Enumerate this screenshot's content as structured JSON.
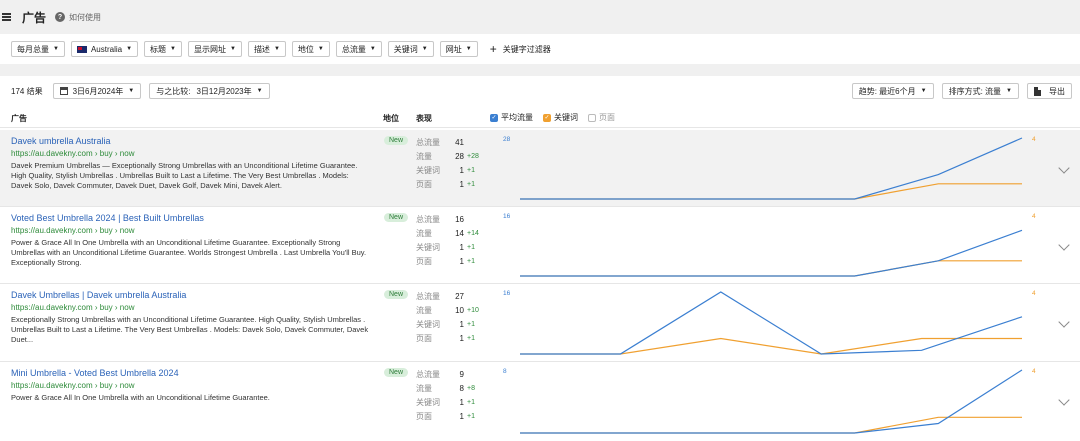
{
  "header": {
    "title": "广告",
    "help_text": "如何使用"
  },
  "filters": [
    {
      "label": "每月总量"
    },
    {
      "label": "Australia",
      "flag": "australia-flag"
    },
    {
      "label": "标题"
    },
    {
      "label": "显示网址"
    },
    {
      "label": "描述"
    },
    {
      "label": "地位"
    },
    {
      "label": "总流量"
    },
    {
      "label": "关键词"
    },
    {
      "label": "网址"
    }
  ],
  "add_filter_label": "关键字过滤器",
  "controls": {
    "results": "174 结果",
    "date": "3日6月2024年",
    "compare_label": "与之比较:",
    "compare_date": "3日12月2023年",
    "trend": "趋势: 最近6个月",
    "sort": "排序方式: 流量",
    "export": "导出"
  },
  "columns": {
    "ad": "广告",
    "position": "地位",
    "performance": "表现"
  },
  "legend": {
    "avg_traffic": "平均流量",
    "keywords": "关键词",
    "pages": "页面",
    "colors": {
      "avg_traffic": "#3b7fd1",
      "keywords": "#f0a030"
    }
  },
  "stat_labels": {
    "total": "总流量",
    "traffic": "流量",
    "keywords": "关键词",
    "pages": "页面"
  },
  "ads": [
    {
      "title": "Davek umbrella Australia",
      "url": "https://au.davekny.com › buy › now",
      "desc": "Davek Premium Umbrellas — Exceptionally Strong Umbrellas with an Unconditional Lifetime Guarantee. High Quality, Stylish Umbrellas . Umbrellas Built to Last a Lifetime. The Very Best Umbrellas . Models: Davek Solo, Davek Commuter, Davek Duet, Davek Golf, Davek Mini, Davek Alert.",
      "badge": "New",
      "total": "41",
      "traffic": "28",
      "traffic_delta": "+28",
      "keywords": "1",
      "keywords_delta": "+1",
      "pages": "1",
      "pages_delta": "+1",
      "axis_left": "28",
      "axis_right": "4",
      "trend_blue": [
        0,
        0,
        0,
        0,
        0,
        0.4,
        1
      ],
      "trend_orange": [
        0,
        0,
        0,
        0,
        0,
        0.25,
        0.25
      ]
    },
    {
      "title": "Voted Best Umbrella 2024 | Best Built Umbrellas",
      "url": "https://au.davekny.com › buy › now",
      "desc": "Power & Grace All In One Umbrella with an Unconditional Lifetime Guarantee. Exceptionally Strong Umbrellas with an Unconditional Lifetime Guarantee. Worlds Strongest Umbrella . Last Umbrella You'll Buy. Exceptionally Strong.",
      "badge": "New",
      "total": "16",
      "traffic": "14",
      "traffic_delta": "+14",
      "keywords": "1",
      "keywords_delta": "+1",
      "pages": "1",
      "pages_delta": "+1",
      "axis_left": "16",
      "axis_right": "4",
      "trend_blue": [
        0,
        0,
        0,
        0,
        0,
        0.25,
        0.75
      ],
      "trend_orange": [
        0,
        0,
        0,
        0,
        0,
        0.25,
        0.25
      ]
    },
    {
      "title": "Davek Umbrellas | Davek umbrella Australia",
      "url": "https://au.davekny.com › buy › now",
      "desc": "Exceptionally Strong Umbrellas with an Unconditional Lifetime Guarantee. High Quality, Stylish Umbrellas . Umbrellas Built to Last a Lifetime. The Very Best Umbrellas . Models: Davek Solo, Davek Commuter, Davek Duet...",
      "badge": "New",
      "total": "27",
      "traffic": "10",
      "traffic_delta": "+10",
      "keywords": "1",
      "keywords_delta": "+1",
      "pages": "1",
      "pages_delta": "+1",
      "axis_left": "16",
      "axis_right": "4",
      "trend_blue": [
        0,
        0,
        1,
        0,
        0.06,
        0.6
      ],
      "trend_orange": [
        0,
        0,
        0.25,
        0,
        0.25,
        0.25
      ]
    },
    {
      "title": "Mini Umbrella - Voted Best Umbrella 2024",
      "url": "https://au.davekny.com › buy › now",
      "desc": "Power & Grace All In One Umbrella with an Unconditional Lifetime Guarantee.",
      "badge": "New",
      "total": "9",
      "traffic": "8",
      "traffic_delta": "+8",
      "keywords": "1",
      "keywords_delta": "+1",
      "pages": "1",
      "pages_delta": "+1",
      "axis_left": "8",
      "axis_right": "4",
      "trend_blue": [
        0,
        0,
        0,
        0,
        0,
        0.15,
        1
      ],
      "trend_orange": [
        0,
        0,
        0,
        0,
        0,
        0.25,
        0.25
      ]
    }
  ]
}
